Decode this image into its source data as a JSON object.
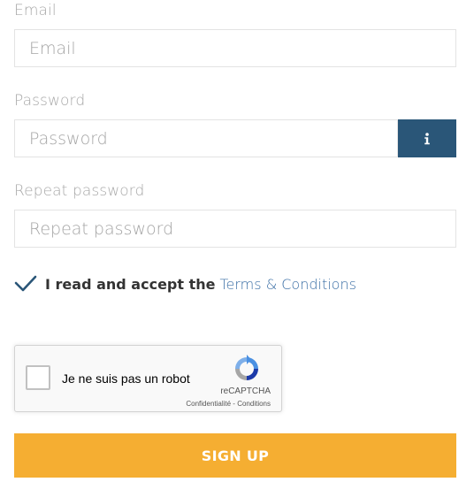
{
  "email": {
    "label": "Email",
    "placeholder": "Email",
    "value": ""
  },
  "password": {
    "label": "Password",
    "placeholder": "Password",
    "value": "",
    "info_icon": "info-icon"
  },
  "repeat_password": {
    "label": "Repeat password",
    "placeholder": "Repeat password",
    "value": ""
  },
  "terms": {
    "checked": true,
    "check_icon": "checkmark-icon",
    "text": "I read and accept the",
    "link_text": "Terms & Conditions"
  },
  "recaptcha": {
    "label": "Je ne suis pas un robot",
    "brand": "reCAPTCHA",
    "privacy": "Confidentialité",
    "separator": " - ",
    "terms": "Conditions",
    "checked": false
  },
  "signup": {
    "label": "SIGN UP"
  },
  "colors": {
    "accent": "#f5ae32",
    "info_button": "#2a5678",
    "link": "#3a6ea5",
    "checkmark": "#2a5678"
  }
}
